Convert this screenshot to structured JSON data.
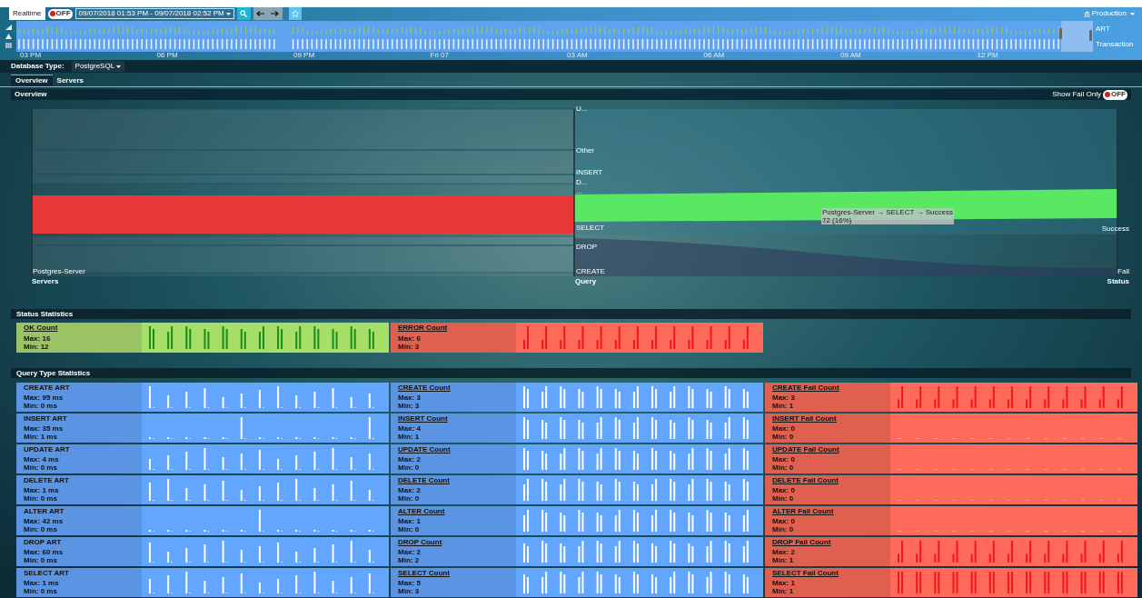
{
  "top_bar": {
    "mode_tab": "Realtime",
    "realtime_toggle": {
      "on": false,
      "label": "OFF"
    },
    "date_range": "09/07/2018 01:53 PM - 09/07/2018 02:52 PM",
    "environment": "Production"
  },
  "timeline": {
    "series_labels": [
      "ART",
      "Transaction"
    ],
    "axis_labels": [
      "03 PM",
      "06 PM",
      "09 PM",
      "Fri 07",
      "03 AM",
      "06 AM",
      "09 AM",
      "12 PM"
    ]
  },
  "filter": {
    "label": "Database Type:",
    "value": "PostgreSQL"
  },
  "tabs": [
    {
      "label": "Overview",
      "selected": true
    },
    {
      "label": "Servers",
      "selected": false
    }
  ],
  "overview": {
    "title": "Overview",
    "show_fail_only": {
      "label": "Show Fail Only",
      "on": false,
      "toggle_text": "OFF"
    },
    "sankey": {
      "columns": [
        {
          "title": "Servers",
          "nodes": [
            "Postgres-Server"
          ]
        },
        {
          "title": "Query",
          "nodes": [
            "U...",
            "Other",
            "INSERT",
            "D...",
            "...",
            "SELECT",
            "DROP",
            "CREATE"
          ]
        },
        {
          "title": "Status",
          "nodes": [
            "Success",
            "Fail"
          ]
        }
      ],
      "tooltip": {
        "path": "Postgres-Server → SELECT → Success",
        "value": "72 (16%)"
      }
    }
  },
  "status_statistics": {
    "title": "Status Statistics",
    "cards": [
      {
        "kind": "ok",
        "title": "OK Count",
        "max": "Max: 16",
        "min": "Min: 12"
      },
      {
        "kind": "error",
        "title": "ERROR Count",
        "max": "Max: 6",
        "min": "Min: 3"
      }
    ]
  },
  "query_type_statistics": {
    "title": "Query Type Statistics",
    "rows": [
      [
        {
          "kind": "art",
          "title": "CREATE ART",
          "max": "Max: 95 ms",
          "min": "Min: 0 ms"
        },
        {
          "kind": "count",
          "title": "CREATE Count",
          "max": "Max: 3",
          "min": "Min: 3"
        },
        {
          "kind": "fail",
          "title": "CREATE Fail Count",
          "max": "Max: 3",
          "min": "Min: 1"
        }
      ],
      [
        {
          "kind": "art",
          "title": "INSERT ART",
          "max": "Max: 35 ms",
          "min": "Min: 1 ms"
        },
        {
          "kind": "count",
          "title": "INSERT Count",
          "max": "Max: 4",
          "min": "Min: 1"
        },
        {
          "kind": "fail",
          "title": "INSERT Fail Count",
          "max": "Max: 0",
          "min": "Min: 0"
        }
      ],
      [
        {
          "kind": "art",
          "title": "UPDATE ART",
          "max": "Max: 4 ms",
          "min": "Min: 0 ms"
        },
        {
          "kind": "count",
          "title": "UPDATE Count",
          "max": "Max: 2",
          "min": "Min: 0"
        },
        {
          "kind": "fail",
          "title": "UPDATE Fail Count",
          "max": "Max: 0",
          "min": "Min: 0"
        }
      ],
      [
        {
          "kind": "art",
          "title": "DELETE ART",
          "max": "Max: 1 ms",
          "min": "Min: 0 ms"
        },
        {
          "kind": "count",
          "title": "DELETE Count",
          "max": "Max: 2",
          "min": "Min: 0"
        },
        {
          "kind": "fail",
          "title": "DELETE Fail Count",
          "max": "Max: 0",
          "min": "Min: 0"
        }
      ],
      [
        {
          "kind": "art",
          "title": "ALTER ART",
          "max": "Max: 42 ms",
          "min": "Min: 0 ms"
        },
        {
          "kind": "count",
          "title": "ALTER Count",
          "max": "Max: 1",
          "min": "Min: 0"
        },
        {
          "kind": "fail",
          "title": "ALTER Fail Count",
          "max": "Max: 0",
          "min": "Min: 0"
        }
      ],
      [
        {
          "kind": "art",
          "title": "DROP ART",
          "max": "Max: 60 ms",
          "min": "Min: 0 ms"
        },
        {
          "kind": "count",
          "title": "DROP Count",
          "max": "Max: 2",
          "min": "Min: 2"
        },
        {
          "kind": "fail",
          "title": "DROP Fail Count",
          "max": "Max: 2",
          "min": "Min: 1"
        }
      ],
      [
        {
          "kind": "art",
          "title": "SELECT ART",
          "max": "Max: 1 ms",
          "min": "Min: 0 ms"
        },
        {
          "kind": "count",
          "title": "SELECT Count",
          "max": "Max: 5",
          "min": "Min: 3"
        },
        {
          "kind": "fail",
          "title": "SELECT Fail Count",
          "max": "Max: 1",
          "min": "Min: 1"
        }
      ]
    ]
  }
}
